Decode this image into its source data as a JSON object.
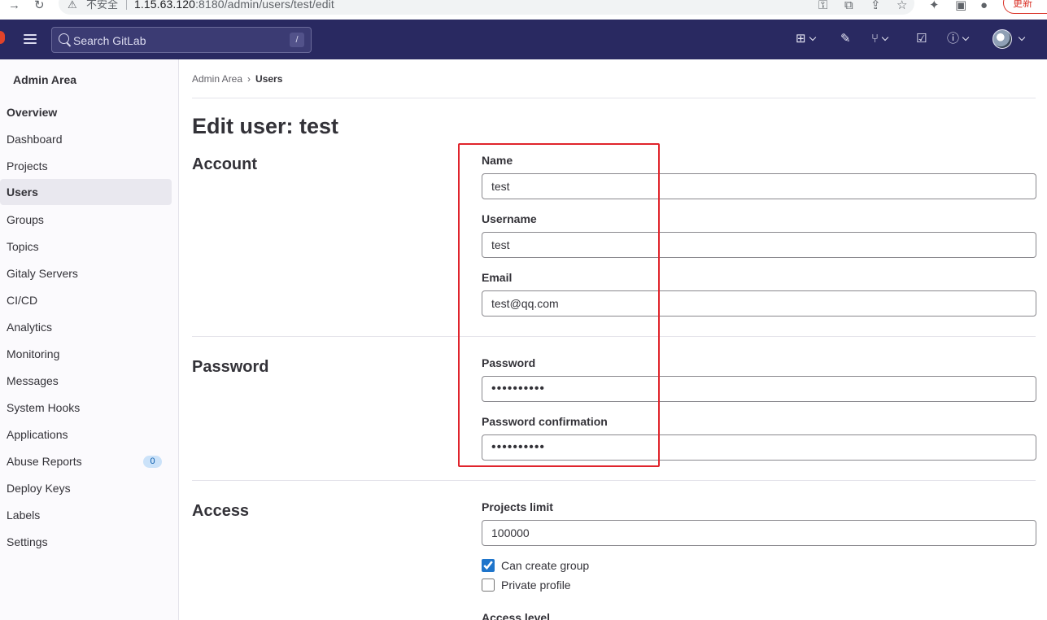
{
  "browser": {
    "insecure_label": "不安全",
    "url_host": "1.15.63.120",
    "url_rest": ":8180/admin/users/test/edit",
    "update_label": "更新"
  },
  "header": {
    "search_placeholder": "Search GitLab",
    "search_shortcut": "/"
  },
  "sidebar": {
    "title": "Admin Area",
    "items": [
      {
        "label": "Overview"
      },
      {
        "label": "Dashboard"
      },
      {
        "label": "Projects"
      },
      {
        "label": "Users"
      },
      {
        "label": "Groups"
      },
      {
        "label": "Topics"
      },
      {
        "label": "Gitaly Servers"
      },
      {
        "label": "CI/CD"
      },
      {
        "label": "Analytics"
      },
      {
        "label": "Monitoring"
      },
      {
        "label": "Messages"
      },
      {
        "label": "System Hooks"
      },
      {
        "label": "Applications"
      },
      {
        "label": "Abuse Reports",
        "badge": "0"
      },
      {
        "label": "Deploy Keys"
      },
      {
        "label": "Labels"
      },
      {
        "label": "Settings"
      }
    ]
  },
  "breadcrumb": {
    "parent": "Admin Area",
    "current": "Users"
  },
  "page": {
    "title": "Edit user: test"
  },
  "account": {
    "heading": "Account",
    "name_label": "Name",
    "name_value": "test",
    "username_label": "Username",
    "username_value": "test",
    "email_label": "Email",
    "email_value": "test@qq.com"
  },
  "password": {
    "heading": "Password",
    "password_label": "Password",
    "password_value": "••••••••••",
    "confirm_label": "Password confirmation",
    "confirm_value": "••••••••••"
  },
  "access": {
    "heading": "Access",
    "projects_limit_label": "Projects limit",
    "projects_limit_value": "100000",
    "can_create_group_label": "Can create group",
    "can_create_group_checked": true,
    "private_profile_label": "Private profile",
    "private_profile_checked": false,
    "access_level_label": "Access level"
  },
  "colors": {
    "header_bg": "#292961",
    "highlight_box": "#e0242c",
    "checkbox_accent": "#1f75cb"
  }
}
